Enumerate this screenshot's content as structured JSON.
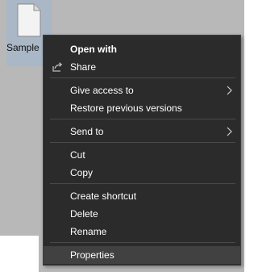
{
  "desktop": {
    "file": {
      "icon": "blank-file-icon",
      "label": "Sample File.ex"
    }
  },
  "context_menu": {
    "header": {
      "label": "Open with"
    },
    "share": {
      "label": "Share",
      "icon": "share-icon"
    },
    "give_access": {
      "label": "Give access to",
      "icon": "chevron-right-icon"
    },
    "restore": {
      "label": "Restore previous versions"
    },
    "send_to": {
      "label": "Send to",
      "icon": "chevron-right-icon"
    },
    "cut": {
      "label": "Cut"
    },
    "copy": {
      "label": "Copy"
    },
    "create_shortcut": {
      "label": "Create shortcut"
    },
    "delete": {
      "label": "Delete"
    },
    "rename": {
      "label": "Rename"
    },
    "properties": {
      "label": "Properties"
    }
  }
}
